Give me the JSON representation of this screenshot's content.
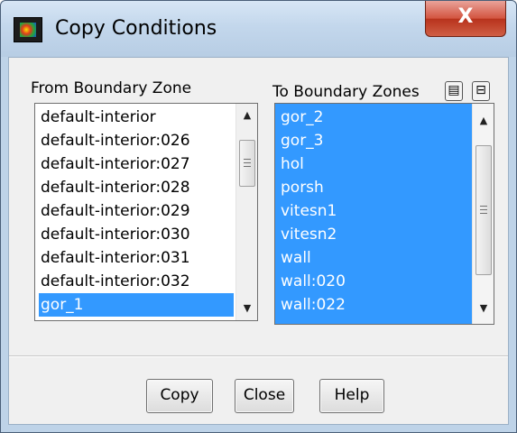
{
  "window": {
    "title": "Copy Conditions",
    "close_glyph": "X",
    "icon": "fluent-app-icon"
  },
  "from_zone": {
    "label": "From Boundary Zone",
    "items": [
      {
        "text": "default-interior",
        "selected": false
      },
      {
        "text": "default-interior:026",
        "selected": false
      },
      {
        "text": "default-interior:027",
        "selected": false
      },
      {
        "text": "default-interior:028",
        "selected": false
      },
      {
        "text": "default-interior:029",
        "selected": false
      },
      {
        "text": "default-interior:030",
        "selected": false
      },
      {
        "text": "default-interior:031",
        "selected": false
      },
      {
        "text": "default-interior:032",
        "selected": false
      },
      {
        "text": "gor_1",
        "selected": true
      }
    ]
  },
  "to_zones": {
    "label": "To Boundary Zones",
    "select_all_icon": "select-all-icon",
    "deselect_all_icon": "deselect-all-icon",
    "items": [
      {
        "text": "gor_2",
        "selected": true
      },
      {
        "text": "gor_3",
        "selected": true
      },
      {
        "text": "hol",
        "selected": true
      },
      {
        "text": "porsh",
        "selected": true
      },
      {
        "text": "vitesn1",
        "selected": true
      },
      {
        "text": "vitesn2",
        "selected": true
      },
      {
        "text": "wall",
        "selected": true
      },
      {
        "text": "wall:020",
        "selected": true
      },
      {
        "text": "wall:022",
        "selected": true
      }
    ]
  },
  "buttons": {
    "copy": "Copy",
    "close": "Close",
    "help": "Help"
  },
  "colors": {
    "selection": "#3399ff",
    "frame": "#bed3e8",
    "close_red": "#c9452d"
  }
}
